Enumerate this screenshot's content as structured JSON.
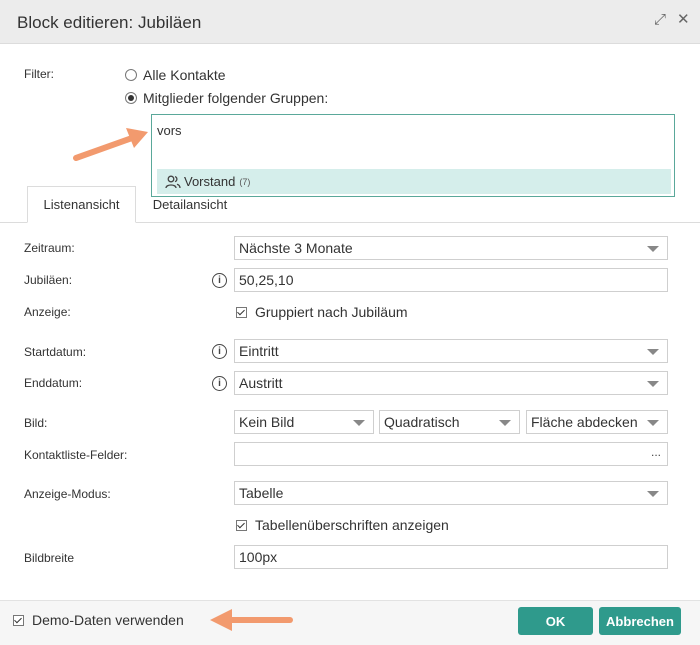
{
  "dialog": {
    "title": "Block editieren: Jubiläen",
    "maximize_icon": "⤢",
    "close_icon": "✕"
  },
  "filter": {
    "label": "Filter:",
    "options": [
      {
        "label": "Alle Kontakte",
        "checked": false
      },
      {
        "label": "Mitglieder folgender Gruppen:",
        "checked": true
      }
    ],
    "search_value": "vors",
    "suggestion": {
      "icon": "group-icon",
      "label": "Vorstand",
      "count": "(7)"
    }
  },
  "tabs": [
    {
      "label": "Listenansicht",
      "active": true
    },
    {
      "label": "Detailansicht",
      "active": false
    }
  ],
  "form": {
    "zeitraum": {
      "label": "Zeitraum:",
      "value": "Nächste 3 Monate"
    },
    "jubilaeen": {
      "label": "Jubiläen:",
      "value": "50,25,10"
    },
    "anzeige": {
      "label": "Anzeige:",
      "checkbox_label": "Gruppiert nach Jubiläum",
      "checked": true
    },
    "startdatum": {
      "label": "Startdatum:",
      "value": "Eintritt"
    },
    "enddatum": {
      "label": "Enddatum:",
      "value": "Austritt"
    },
    "bild": {
      "label": "Bild:",
      "values": [
        "Kein Bild",
        "Quadratisch",
        "Fläche abdecken"
      ]
    },
    "kontaktliste": {
      "label": "Kontaktliste-Felder:",
      "value": "",
      "button": "..."
    },
    "anzeige_modus": {
      "label": "Anzeige-Modus:",
      "value": "Tabelle",
      "checkbox_label": "Tabellenüberschriften anzeigen",
      "checked": true
    },
    "bildbreite": {
      "label": "Bildbreite",
      "value": "100px"
    }
  },
  "footer": {
    "demo_label": "Demo-Daten verwenden",
    "demo_checked": true,
    "ok_label": "OK",
    "cancel_label": "Abbrechen"
  },
  "colors": {
    "accent": "#2f9a8c",
    "suggestion_bg": "#d5eeeb",
    "arrow": "#f29a6e"
  }
}
